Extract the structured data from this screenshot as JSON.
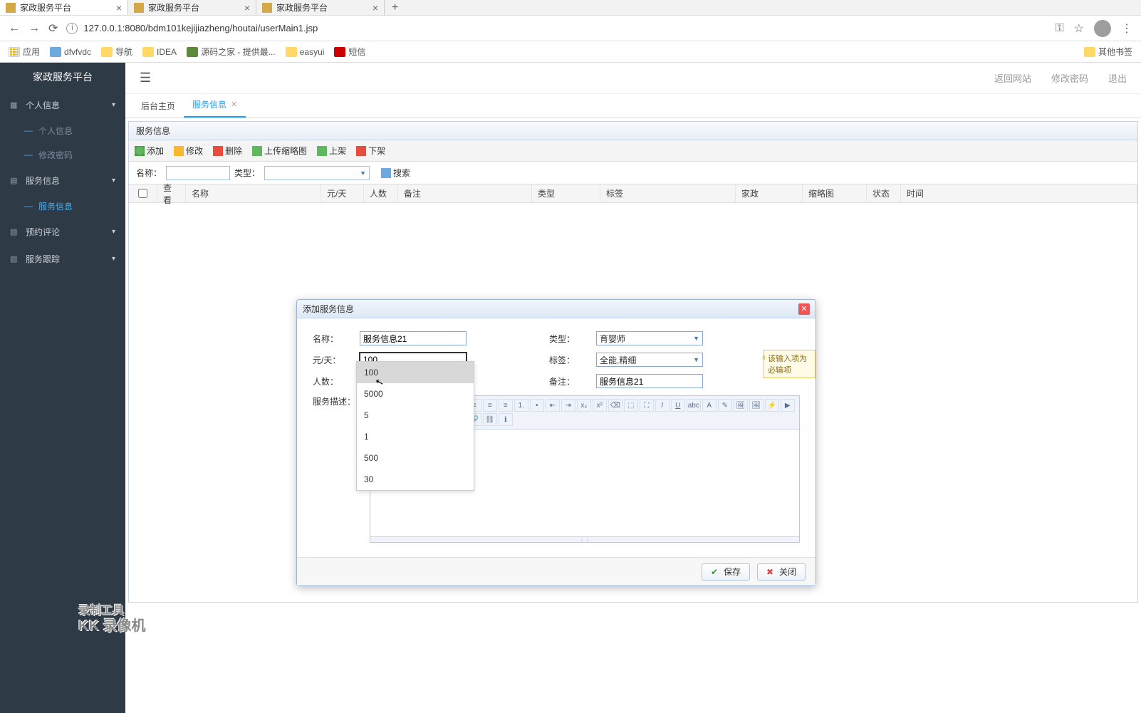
{
  "browser": {
    "tabs": [
      "家政服务平台",
      "家政服务平台",
      "家政服务平台"
    ],
    "url": "127.0.0.1:8080/bdm101kejijiazheng/houtai/userMain1.jsp",
    "key_icon": "⚿",
    "star_icon": "☆",
    "menu_icon": "⋮"
  },
  "bookmarks": {
    "apps": "应用",
    "items": [
      "dfvfvdc",
      "导航",
      "IDEA",
      "源码之家 - 提供最...",
      "easyui",
      "短信"
    ],
    "other": "其他书签"
  },
  "sidebar": {
    "title": "家政服务平台",
    "groups": [
      {
        "label": "个人信息",
        "expanded": true,
        "items": [
          "个人信息",
          "修改密码"
        ]
      },
      {
        "label": "服务信息",
        "expanded": true,
        "items": [
          "服务信息"
        ],
        "active_item": 0
      },
      {
        "label": "预约评论",
        "expanded": false
      },
      {
        "label": "服务跟踪",
        "expanded": false
      }
    ]
  },
  "topbar": {
    "links": [
      "返回网站",
      "修改密码",
      "退出"
    ]
  },
  "tabs": {
    "items": [
      {
        "label": "后台主页",
        "closable": false
      },
      {
        "label": "服务信息",
        "closable": true,
        "active": true
      }
    ]
  },
  "panel": {
    "title": "服务信息",
    "toolbar": [
      "添加",
      "修改",
      "删除",
      "上传缩略图",
      "上架",
      "下架"
    ],
    "filter": {
      "name_label": "名称：",
      "type_label": "类型：",
      "search": "搜索"
    },
    "columns": [
      "",
      "查看",
      "名称",
      "元/天",
      "人数",
      "备注",
      "类型",
      "标签",
      "家政",
      "缩略图",
      "状态",
      "时间"
    ]
  },
  "dialog": {
    "title": "添加服务信息",
    "fields": {
      "name_lbl": "名称：",
      "name_val": "服务信息21",
      "type_lbl": "类型：",
      "type_val": "育婴师",
      "price_lbl": "元/天：",
      "price_val": "100",
      "tag_lbl": "标签：",
      "tag_val": "全能,精细",
      "people_lbl": "人数：",
      "remark_lbl": "备注：",
      "remark_val": "服务信息21",
      "desc_lbl": "服务描述："
    },
    "tip": "该输入项为必输项",
    "save": "保存",
    "close": "关闭"
  },
  "autocomplete": [
    "100",
    "5000",
    "5",
    "1",
    "500",
    "30"
  ],
  "watermark": {
    "l1": "录制工具",
    "l2": "KK 录像机"
  }
}
